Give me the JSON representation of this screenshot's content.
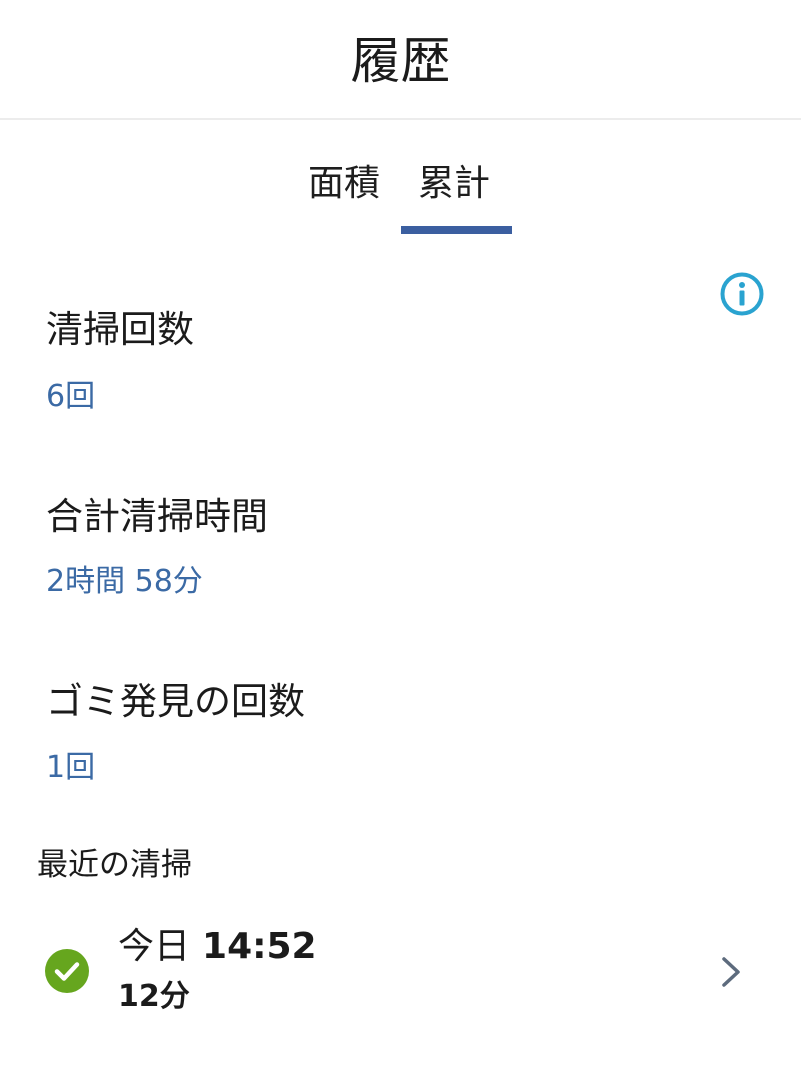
{
  "header": {
    "title": "履歴"
  },
  "tabs": [
    {
      "label": "面積",
      "selected": false
    },
    {
      "label": "累計",
      "selected": true
    }
  ],
  "icons": {
    "info": "info-icon",
    "check": "check-circle-icon",
    "chevron": "chevron-right-icon"
  },
  "colors": {
    "accent": "#3b5fa0",
    "value_text": "#3b6aa5",
    "info": "#2aa3d0",
    "success": "#66a61e"
  },
  "stats": [
    {
      "label": "清掃回数",
      "value": "6回"
    },
    {
      "label": "合計清掃時間",
      "value": "2時間 58分"
    },
    {
      "label": "ゴミ発見の回数",
      "value": "1回"
    }
  ],
  "recent": {
    "title": "最近の清掃",
    "items": [
      {
        "day": "今日",
        "time": "14:52",
        "duration": "12分"
      }
    ]
  }
}
